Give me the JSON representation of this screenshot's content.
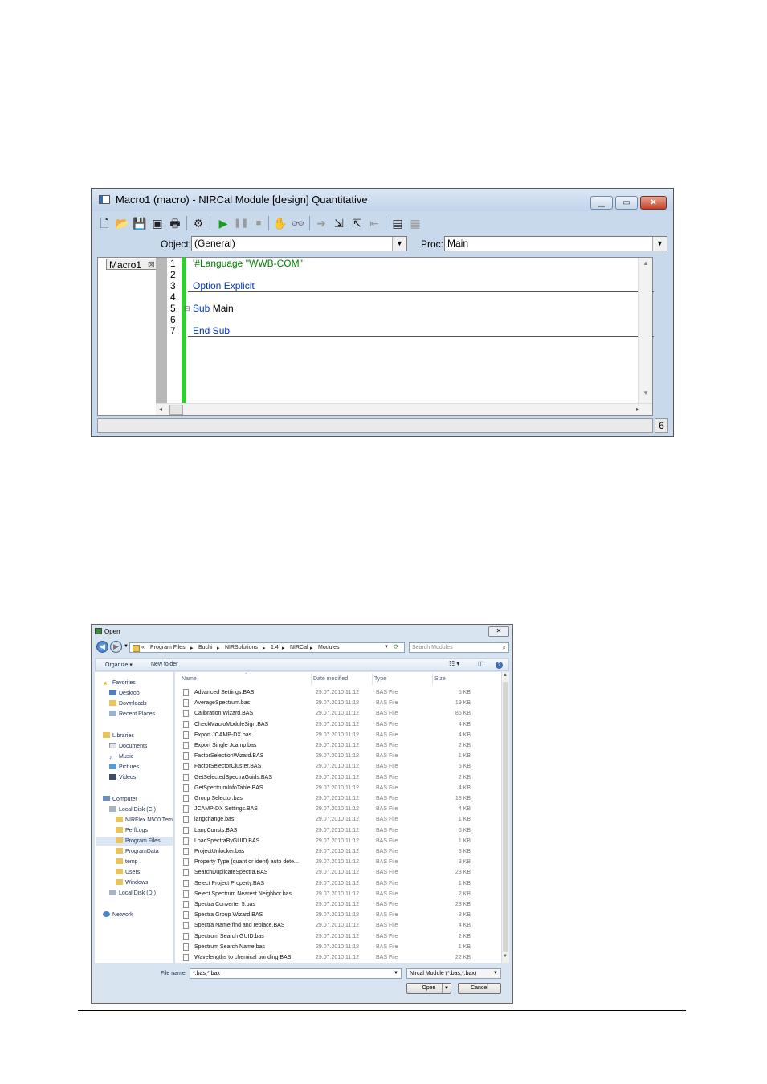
{
  "macro_window": {
    "title": "Macro1 (macro) - NIRCal Module [design] Quantitative",
    "object_label": "Object:",
    "object_value": "(General)",
    "proc_label": "Proc:",
    "proc_value": "Main",
    "tab_label": "Macro1",
    "line_numbers": [
      "1",
      "2",
      "3",
      "4",
      "5",
      "6",
      "7"
    ],
    "code": {
      "l1": "'#Language \"WWB-COM\"",
      "l3_kw": "Option",
      "l3_rest": " Explicit",
      "l5_kw": "Sub",
      "l5_rest": " Main",
      "l7": "End Sub"
    },
    "status_number": "6"
  },
  "open_dialog": {
    "title": "Open",
    "address": [
      "«",
      "Program Files",
      "▸",
      "Buchi",
      "▸",
      "NIRSolutions",
      "▸",
      "1.4",
      "▸",
      "NIRCal",
      "▸",
      "Modules"
    ],
    "search_placeholder": "Search Modules",
    "organize": "Organize ▾",
    "new_folder": "New folder",
    "nav": [
      {
        "label": "Favorites"
      },
      {
        "label": "Desktop"
      },
      {
        "label": "Downloads"
      },
      {
        "label": "Recent Places"
      },
      {
        "label": "Libraries"
      },
      {
        "label": "Documents"
      },
      {
        "label": "Music"
      },
      {
        "label": "Pictures"
      },
      {
        "label": "Videos"
      },
      {
        "label": "Computer"
      },
      {
        "label": "Local Disk (C:)"
      },
      {
        "label": "NIRFlex N500 Tem"
      },
      {
        "label": "PerfLogs"
      },
      {
        "label": "Program Files"
      },
      {
        "label": "ProgramData"
      },
      {
        "label": "temp"
      },
      {
        "label": "Users"
      },
      {
        "label": "Windows"
      },
      {
        "label": "Local Disk (D:)"
      },
      {
        "label": "Network"
      }
    ],
    "columns": {
      "name": "Name",
      "date": "Date modified",
      "type": "Type",
      "size": "Size"
    },
    "files": [
      {
        "name": "Advanced Settings.BAS",
        "date": "29.07.2010 11:12",
        "type": "BAS File",
        "size": "5 KB"
      },
      {
        "name": "AverageSpectrum.bas",
        "date": "29.07.2010 11:12",
        "type": "BAS File",
        "size": "19 KB"
      },
      {
        "name": "Calibration Wizard.BAS",
        "date": "29.07.2010 11:12",
        "type": "BAS File",
        "size": "86 KB"
      },
      {
        "name": "CheckMacroModuleSign.BAS",
        "date": "29.07.2010 11:12",
        "type": "BAS File",
        "size": "4 KB"
      },
      {
        "name": "Export JCAMP-DX.bas",
        "date": "29.07.2010 11:12",
        "type": "BAS File",
        "size": "4 KB"
      },
      {
        "name": "Export Single Jcamp.bas",
        "date": "29.07.2010 11:12",
        "type": "BAS File",
        "size": "2 KB"
      },
      {
        "name": "FactorSelectionWizard.BAS",
        "date": "29.07.2010 11:12",
        "type": "BAS File",
        "size": "1 KB"
      },
      {
        "name": "FactorSelectorCluster.BAS",
        "date": "29.07.2010 11:12",
        "type": "BAS File",
        "size": "5 KB"
      },
      {
        "name": "GetSelectedSpectraGuids.BAS",
        "date": "29.07.2010 11:12",
        "type": "BAS File",
        "size": "2 KB"
      },
      {
        "name": "GetSpectrumInfoTable.BAS",
        "date": "29.07.2010 11:12",
        "type": "BAS File",
        "size": "4 KB"
      },
      {
        "name": "Group Selector.bas",
        "date": "29.07.2010 11:12",
        "type": "BAS File",
        "size": "18 KB"
      },
      {
        "name": "JCAMP-DX Settings.BAS",
        "date": "29.07.2010 11:12",
        "type": "BAS File",
        "size": "4 KB"
      },
      {
        "name": "langchange.bas",
        "date": "29.07.2010 11:12",
        "type": "BAS File",
        "size": "1 KB"
      },
      {
        "name": "LangConsts.BAS",
        "date": "29.07.2010 11:12",
        "type": "BAS File",
        "size": "6 KB"
      },
      {
        "name": "LoadSpectraByGUID.BAS",
        "date": "29.07.2010 11:12",
        "type": "BAS File",
        "size": "1 KB"
      },
      {
        "name": "ProjectUnlocker.bas",
        "date": "29.07.2010 11:12",
        "type": "BAS File",
        "size": "3 KB"
      },
      {
        "name": "Property Type (quant or ident) auto dete...",
        "date": "29.07.2010 11:12",
        "type": "BAS File",
        "size": "3 KB"
      },
      {
        "name": "SearchDuplicateSpectra.BAS",
        "date": "29.07.2010 11:12",
        "type": "BAS File",
        "size": "23 KB"
      },
      {
        "name": "Select Project Property.BAS",
        "date": "29.07.2010 11:12",
        "type": "BAS File",
        "size": "1 KB"
      },
      {
        "name": "Select Spectrum Nearest Neighbor.bas",
        "date": "29.07.2010 11:12",
        "type": "BAS File",
        "size": "2 KB"
      },
      {
        "name": "Spectra Converter 5.bas",
        "date": "29.07.2010 11:12",
        "type": "BAS File",
        "size": "23 KB"
      },
      {
        "name": "Spectra Group Wizard.BAS",
        "date": "29.07.2010 11:12",
        "type": "BAS File",
        "size": "3 KB"
      },
      {
        "name": "Spectra Name find and replace.BAS",
        "date": "29.07.2010 11:12",
        "type": "BAS File",
        "size": "4 KB"
      },
      {
        "name": "Spectrum Search GUID.bas",
        "date": "29.07.2010 11:12",
        "type": "BAS File",
        "size": "2 KB"
      },
      {
        "name": "Spectrum Search Name.bas",
        "date": "29.07.2010 11:12",
        "type": "BAS File",
        "size": "1 KB"
      },
      {
        "name": "Wavelengths to chemical bonding.BAS",
        "date": "29.07.2010 11:12",
        "type": "BAS File",
        "size": "22 KB"
      }
    ],
    "file_name_label": "File name:",
    "file_name_value": "*.bas;*.bax",
    "filter_value": "Nircal Module (*.bas;*.bax)",
    "open_label": "Open",
    "cancel_label": "Cancel"
  }
}
